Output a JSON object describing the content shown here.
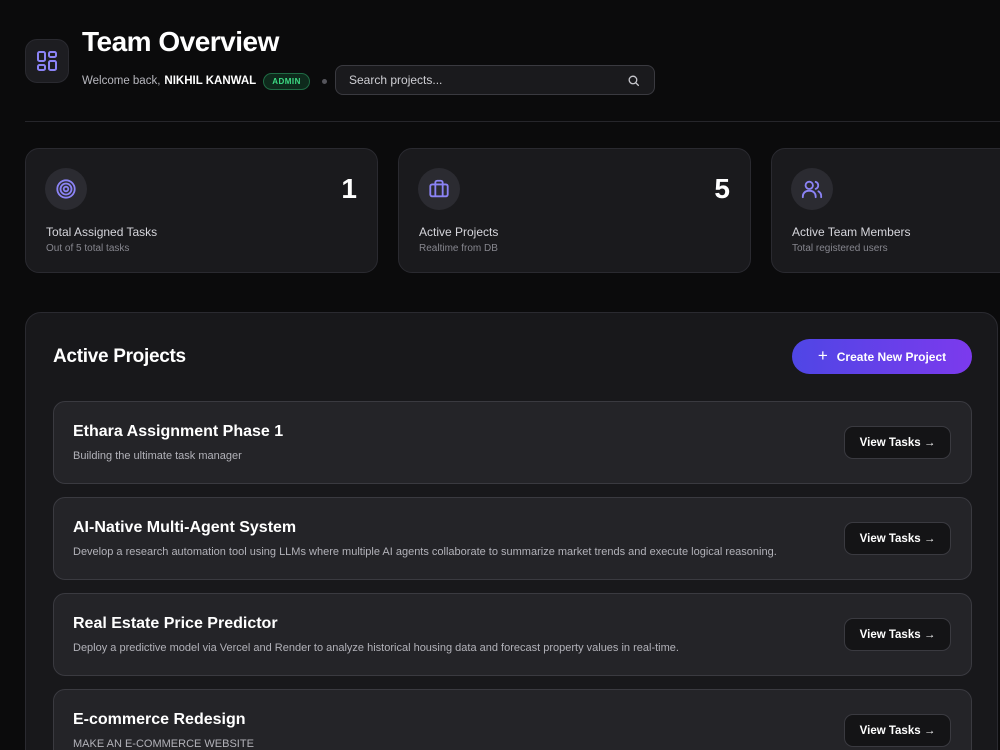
{
  "header": {
    "title": "Team Overview",
    "welcome_prefix": "Welcome back,",
    "user_name": "NIKHIL KANWAL",
    "role_badge": "ADMIN",
    "search_placeholder": "Search projects...",
    "logo_icon": "layout-grid-icon"
  },
  "colors": {
    "accent_start": "#4f46e5",
    "accent_end": "#7c3aed",
    "icon_accent": "#8b83f5",
    "badge_green": "#3ddc84"
  },
  "stats": [
    {
      "icon": "target-icon",
      "value": "1",
      "label": "Total Assigned Tasks",
      "sub": "Out of 5 total tasks"
    },
    {
      "icon": "briefcase-icon",
      "value": "5",
      "label": "Active Projects",
      "sub": "Realtime from DB"
    },
    {
      "icon": "users-icon",
      "value": "",
      "label": "Active Team Members",
      "sub": "Total registered users"
    }
  ],
  "projects_panel": {
    "title": "Active Projects",
    "create_label": "Create New Project",
    "view_label": "View Tasks →",
    "projects": [
      {
        "title": "Ethara Assignment Phase 1",
        "description": "Building the ultimate task manager"
      },
      {
        "title": "AI-Native Multi-Agent System",
        "description": "Develop a research automation tool using LLMs where multiple AI agents collaborate to summarize market trends and execute logical reasoning."
      },
      {
        "title": "Real Estate Price Predictor",
        "description": "Deploy a predictive model via Vercel and Render to analyze historical housing data and forecast property values in real-time."
      },
      {
        "title": "E-commerce Redesign",
        "description": "MAKE AN E-COMMERCE WEBSITE"
      }
    ]
  }
}
